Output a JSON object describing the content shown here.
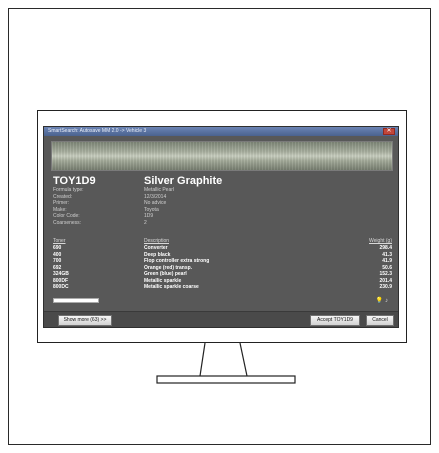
{
  "window": {
    "title": "SmartSearch: Autosave MM 2.0 -> Vehicle 3",
    "close_glyph": "✕"
  },
  "color": {
    "code": "TOY1D9",
    "name": "Silver Graphite"
  },
  "properties": [
    {
      "label": "Formula type:",
      "value": "Metallic Pearl"
    },
    {
      "label": "Created:",
      "value": "12/3/2014"
    },
    {
      "label": "Primer:",
      "value": "No advice"
    },
    {
      "label": "Make:",
      "value": "Toyota"
    },
    {
      "label": "Color Code:",
      "value": "1D9"
    },
    {
      "label": "Coarseness:",
      "value": "2"
    }
  ],
  "table": {
    "headers": {
      "toner": "Toner",
      "description": "Description",
      "weight": "Weight (g)"
    },
    "rows": [
      {
        "toner": "690",
        "description": "Converter",
        "weight": "298.4"
      },
      {
        "toner": "400",
        "description": "Deep black",
        "weight": "41.3"
      },
      {
        "toner": "700",
        "description": "Flop controller extra strong",
        "weight": "41.9"
      },
      {
        "toner": "692",
        "description": "Orange (red) transp.",
        "weight": "50.6"
      },
      {
        "toner": "324GB",
        "description": "Green (blue) pearl",
        "weight": "152.3"
      },
      {
        "toner": "800DF",
        "description": "Metallic sparkle",
        "weight": "201.4"
      },
      {
        "toner": "800DC",
        "description": "Metallic sparkle coarse",
        "weight": "230.9"
      }
    ]
  },
  "icons": {
    "bulb": "bulb-icon",
    "note": "note-icon"
  },
  "footer": {
    "show_more": "Show more (63) >>",
    "accept": "Accept TOY1D9",
    "cancel": "Cancel"
  }
}
